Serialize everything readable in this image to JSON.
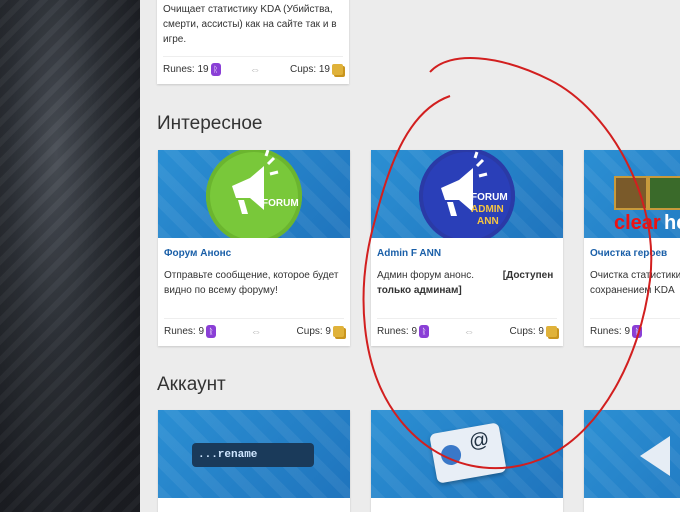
{
  "top_card": {
    "desc": "Очищает статистику KDA (Убийства, смерти, ассисты) как на сайте так и в игре.",
    "runes": "Runes: 19",
    "cups": "Cups: 19"
  },
  "section_interesting": {
    "title": "Интересное"
  },
  "interesting_cards": [
    {
      "title": "Форум Анонс",
      "desc": "Отправьте сообщение, которое будет видно по всему форуму!",
      "runes": "Runes: 9",
      "cups": "Cups: 9",
      "logo_text": "FORUM"
    },
    {
      "title": "Admin F ANN",
      "desc": "Админ форум анонс.",
      "desc_bold": "[Доступен только админам]",
      "runes": "Runes: 9",
      "cups": "Cups: 9",
      "logo_text": "FORUM",
      "logo_sub1": "ADMIN",
      "logo_sub2": "ANN"
    },
    {
      "title": "Очистка героев",
      "desc": "Очистка статистики героев с сохранением KDA",
      "runes": "Runes: 9",
      "banner_text_red": "clear",
      "banner_text_white": "he"
    }
  ],
  "section_account": {
    "title": "Аккаунт"
  },
  "account_cards": [
    {
      "banner_text": "...rename"
    },
    {
      "banner_text": "@"
    },
    {
      "banner_text": ""
    }
  ],
  "colors": {
    "link_blue": "#1a5fa8",
    "rune_purple": "#8a3fd6",
    "cups_gold": "#e0b23a",
    "annotation_red": "#d21f1f"
  }
}
